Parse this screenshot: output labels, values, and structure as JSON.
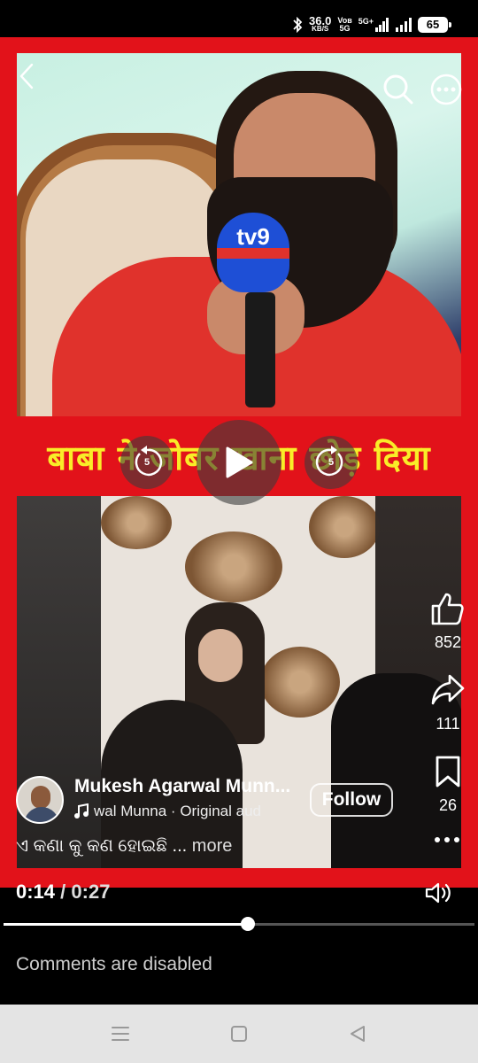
{
  "status_bar": {
    "network_speed": "36.0",
    "speed_unit": "KB/S",
    "volte": "Voʙ",
    "volte_sub": "5G",
    "signal_1": "5G+",
    "battery": "65"
  },
  "video": {
    "overlay_caption": "बाबा ने जोबर खाना छोड़ दिया",
    "mic_logo": "tv9",
    "skip_back_seconds": "5",
    "skip_forward_seconds": "5",
    "progress": 0.519
  },
  "reactions": {
    "likes": "852",
    "shares": "111",
    "saves": "26"
  },
  "author": {
    "name": "Mukesh Agarwal Munn...",
    "audio": "wal Munna · Original aud",
    "follow_label": "Follow"
  },
  "post": {
    "caption": "ଏ କଣା କୁ କଣ ହୋଇଛି ...",
    "more_label": "more"
  },
  "playback": {
    "current_time": "0:14",
    "separator": "/",
    "total_time": "0:27"
  },
  "comments": {
    "status": "Comments are disabled"
  },
  "icons": {
    "back": "chevron-left-icon",
    "search": "search-icon",
    "more": "more-horizontal-icon",
    "like": "thumbs-up-icon",
    "share": "share-arrow-icon",
    "save": "bookmark-icon",
    "volume": "volume-icon",
    "music": "music-note-icon"
  },
  "colors": {
    "frame_red": "#e2121a",
    "caption_yellow": "#f9ed28"
  }
}
